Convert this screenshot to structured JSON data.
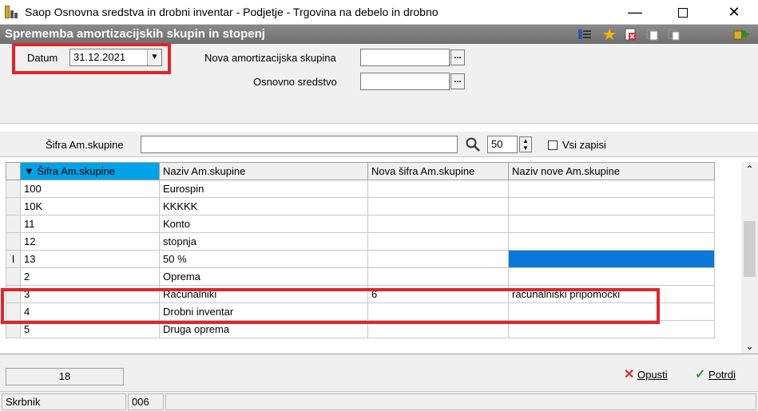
{
  "window": {
    "title": "Saop Osnovna sredstva in drobni inventar - Podjetje - Trgovina na debelo in drobno",
    "minimize": "—",
    "close": "✕"
  },
  "subheader": {
    "title": "Sprememba amortizacijskih skupin in stopenj"
  },
  "form": {
    "datum_label": "Datum",
    "datum_value": "31.12.2021",
    "nova_skupina_label": "Nova amortizacijska skupina",
    "nova_skupina_value": "",
    "osnovno_sredstvo_label": "Osnovno sredstvo",
    "osnovno_sredstvo_value": "",
    "dots": "..."
  },
  "search": {
    "label": "Šifra Am.skupine",
    "value": "",
    "count": "50",
    "vsi_zapisi_label": "Vsi zapisi"
  },
  "grid": {
    "columns": [
      "▼ Šifra Am.skupine",
      "Naziv Am.skupine",
      "Nova šifra Am.skupine",
      "Naziv nove Am.skupine"
    ],
    "rows": [
      [
        "100",
        "Eurospin",
        "",
        ""
      ],
      [
        "10K",
        "KKKKK",
        "",
        ""
      ],
      [
        "11",
        "Konto",
        "",
        ""
      ],
      [
        "12",
        "stopnja",
        "",
        ""
      ],
      [
        "13",
        "50 %",
        "",
        ""
      ],
      [
        "2",
        "Oprema",
        "",
        ""
      ],
      [
        "3",
        "Računalniki",
        "6",
        "računalniški pripomočki"
      ],
      [
        "4",
        "Drobni inventar",
        "",
        ""
      ],
      [
        "5",
        "Druga oprema",
        "",
        ""
      ]
    ],
    "current_row_marker": "I"
  },
  "footer": {
    "record_count": "18",
    "cancel_label": "Opusti",
    "confirm_label": "Potrdi"
  },
  "status": {
    "user": "Skrbnik",
    "code": "006"
  },
  "colors": {
    "highlight_red": "#e0252b",
    "selection_blue": "#0a78d7",
    "sorted_header": "#00a2e8"
  }
}
